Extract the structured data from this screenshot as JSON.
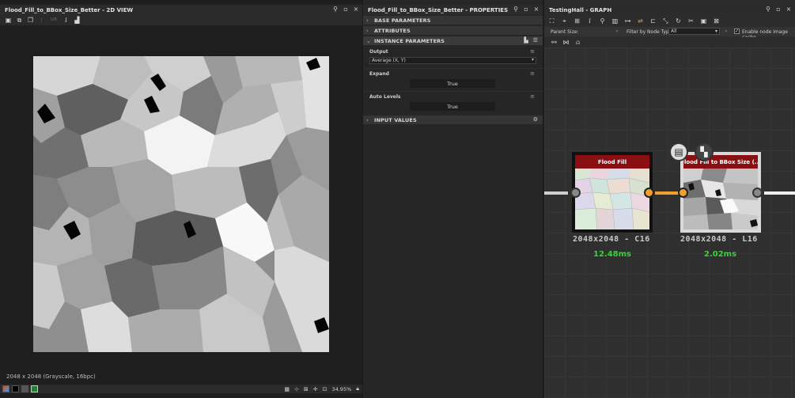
{
  "colors": {
    "accent_orange": "#f0a030",
    "node_header": "#8a0f12",
    "timing_green": "#33d633"
  },
  "view2d": {
    "title": "Flood_Fill_to_BBox_Size_Better - 2D VIEW",
    "toolbar_icons": [
      "save-icon",
      "copy-icon",
      "layers-icon",
      "channels-icon",
      "info-icon",
      "histogram-icon"
    ],
    "toolbar_label": "LIB",
    "image_info": "2048 x 2048 (Grayscale, 16bpc)",
    "zoom": "34.95%"
  },
  "properties": {
    "title": "Flood_Fill_to_BBox_Size_Better - PROPERTIES",
    "sections": {
      "base": "BASE PARAMETERS",
      "attributes": "ATTRIBUTES",
      "instance": "INSTANCE PARAMETERS",
      "input": "INPUT VALUES"
    },
    "params": {
      "output_label": "Output",
      "output_value": "Average (X, Y)",
      "expand_label": "Expand",
      "expand_value": "True",
      "autolevels_label": "Auto Levels",
      "autolevels_value": "True"
    }
  },
  "graph": {
    "title": "TestingHall - GRAPH",
    "parent_size_label": "Parent Size:",
    "filter_label": "Filter by Node Type:",
    "filter_value": "All",
    "cache_label": "Enable node image cache",
    "nodes": [
      {
        "name": "Flood Fill",
        "resolution": "2048x2048 - C16",
        "time": "12.48ms"
      },
      {
        "name": "Flood Fill to BBox Size (...",
        "resolution": "2048x2048 - L16",
        "time": "2.02ms"
      }
    ]
  }
}
